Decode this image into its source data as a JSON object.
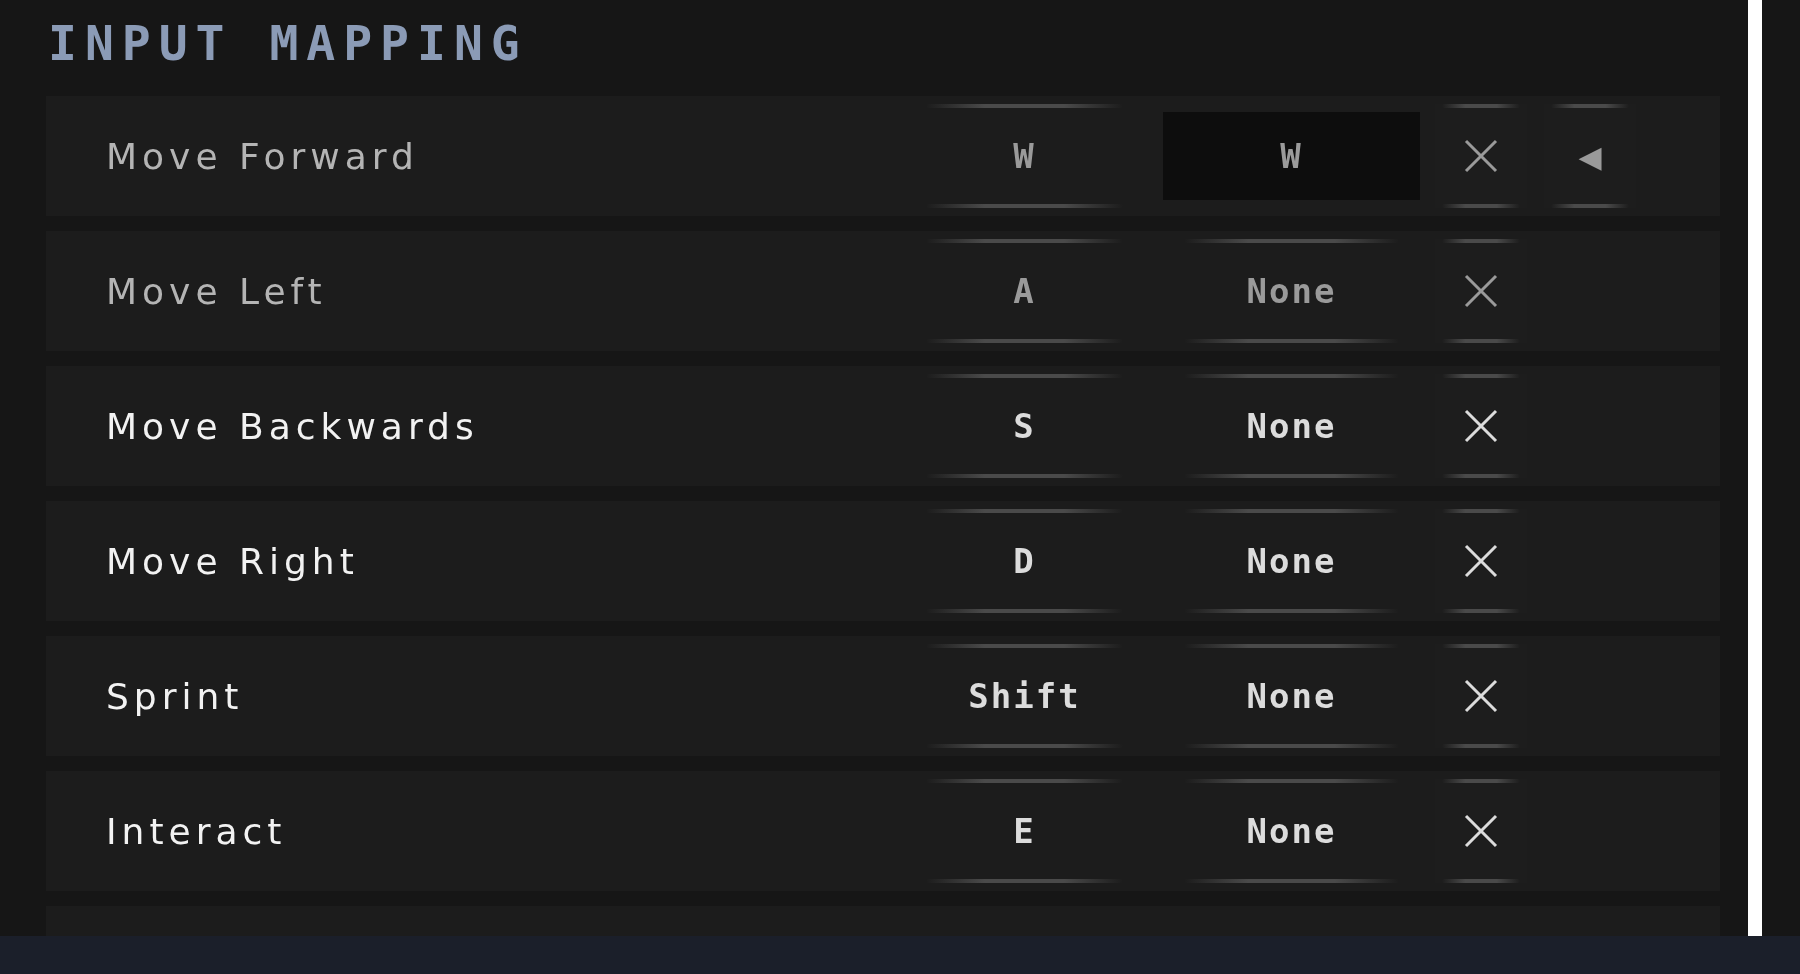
{
  "title": "INPUT MAPPING",
  "rows": [
    {
      "label": "Move Forward",
      "dimmed": true,
      "primary": "W",
      "secondary": "W",
      "listening": true,
      "arrow": "◀"
    },
    {
      "label": "Move Left",
      "dimmed": true,
      "primary": "A",
      "secondary": "None",
      "listening": false
    },
    {
      "label": "Move Backwards",
      "dimmed": false,
      "primary": "S",
      "secondary": "None",
      "listening": false
    },
    {
      "label": "Move Right",
      "dimmed": false,
      "primary": "D",
      "secondary": "None",
      "listening": false
    },
    {
      "label": "Sprint",
      "dimmed": false,
      "primary": "Shift",
      "secondary": "None",
      "listening": false
    },
    {
      "label": "Interact",
      "dimmed": false,
      "primary": "E",
      "secondary": "None",
      "listening": false
    }
  ]
}
